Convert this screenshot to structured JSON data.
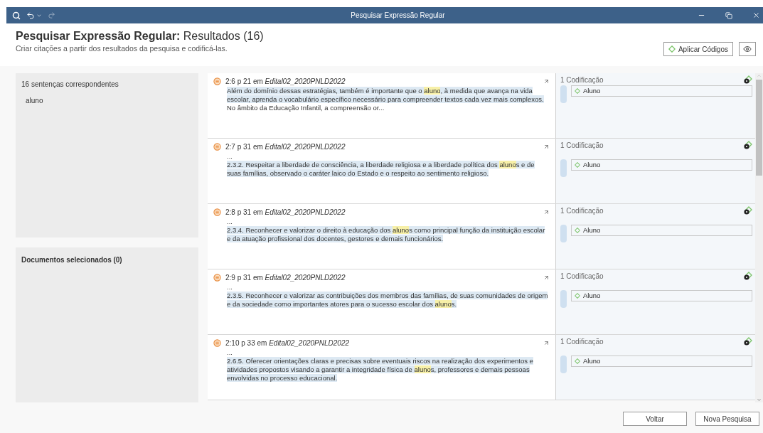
{
  "window": {
    "title": "Pesquisar Expressão Regular"
  },
  "header": {
    "title_bold": "Pesquisar Expressão Regular:",
    "title_rest": "Resultados (16)",
    "subtitle": "Criar citações a partir dos resultados da pesquisa e codificá-las.",
    "apply_button": "Aplicar Códigos"
  },
  "matches_panel": {
    "title": "16 sentenças correspondentes",
    "items": [
      "aluno"
    ]
  },
  "documents_panel": {
    "title": "Documentos selecionados (0)"
  },
  "results": [
    {
      "ref": "2:6 p 21 em",
      "doc": "Edital02_2020PNLD2022",
      "segments": [
        {
          "kind": "quote",
          "text": "Além do domínio dessas estratégias, também é importante que o "
        },
        {
          "kind": "match",
          "text": "aluno"
        },
        {
          "kind": "quote",
          "text": ", à medida que avança na  vida escolar, aprenda o vocabulário específico necessário para compreender textos cada vez mais  complexos."
        },
        {
          "kind": "plain",
          "text": " No âmbito da Educação Infantil, a compreensão or..."
        }
      ],
      "coding_count": "1 Codificação",
      "codes": [
        "Aluno"
      ]
    },
    {
      "ref": "2:7 p 31 em",
      "doc": "Edital02_2020PNLD2022",
      "lead": "...",
      "segments": [
        {
          "kind": "quote",
          "text": "2.3.2. Respeitar a liberdade de consciência, a liberdade religiosa e a liberdade política dos "
        },
        {
          "kind": "match",
          "text": "aluno"
        },
        {
          "kind": "quote",
          "text": "s e  de suas famílias, observado o caráter laico do Estado e o respeito ao sentimento religioso."
        }
      ],
      "coding_count": "1 Codificação",
      "codes": [
        "Aluno"
      ]
    },
    {
      "ref": "2:8 p 31 em",
      "doc": "Edital02_2020PNLD2022",
      "lead": "...",
      "segments": [
        {
          "kind": "quote",
          "text": "2.3.4. Reconhecer e valorizar o direito à educação dos "
        },
        {
          "kind": "match",
          "text": "aluno"
        },
        {
          "kind": "quote",
          "text": "s como principal função da instituição  escolar e da atuação profissional dos docentes, gestores e demais funcionários."
        }
      ],
      "coding_count": "1 Codificação",
      "codes": [
        "Aluno"
      ]
    },
    {
      "ref": "2:9 p 31 em",
      "doc": "Edital02_2020PNLD2022",
      "lead": "...",
      "segments": [
        {
          "kind": "quote",
          "text": "2.3.5. Reconhecer e valorizar as contribuições dos membros das famílias, de suas comunidades de  origem e da sociedade como importantes atores para o sucesso escolar dos "
        },
        {
          "kind": "match",
          "text": "aluno"
        },
        {
          "kind": "quote",
          "text": "s."
        }
      ],
      "coding_count": "1 Codificação",
      "codes": [
        "Aluno"
      ]
    },
    {
      "ref": "2:10 p 33 em",
      "doc": "Edital02_2020PNLD2022",
      "lead": "...",
      "segments": [
        {
          "kind": "quote",
          "text": "2.6.5. Oferecer orientações claras e precisas sobre eventuais riscos na realização dos experimentos  e atividades propostos visando a garantir a integridade física de "
        },
        {
          "kind": "match",
          "text": "aluno"
        },
        {
          "kind": "quote",
          "text": "s, professores e demais  pessoas envolvidas no processo educacional."
        }
      ],
      "coding_count": "1 Codificação",
      "codes": [
        "Aluno"
      ]
    }
  ],
  "footer": {
    "buttons": [
      "Voltar",
      "Nova Pesquisa"
    ]
  }
}
